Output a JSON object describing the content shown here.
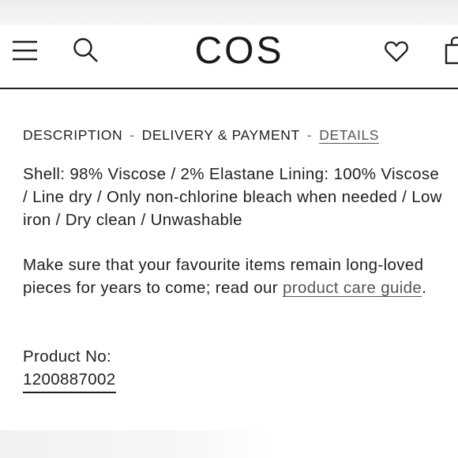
{
  "header": {
    "logo_text": "COS",
    "icons": [
      "menu-icon",
      "search-icon",
      "heart-icon",
      "bag-icon"
    ]
  },
  "tabs": {
    "description": "DESCRIPTION",
    "separator": "-",
    "delivery": "DELIVERY & PAYMENT",
    "details": "DETAILS",
    "active": "DETAILS"
  },
  "details": {
    "composition_care": "Shell: 98% Viscose / 2% Elastane Lining: 100% Viscose / Line dry / Only non-chlorine bleach when needed / Low iron / Dry clean / Unwashable",
    "care_text_before_link": "Make sure that your favourite items remain long-loved pieces for years to come; read our ",
    "care_link": "product care guide",
    "care_text_after_link": ".",
    "product_no_label": "Product No:",
    "product_no_value": "1200887002"
  },
  "colors": {
    "text": "#1f1f1f",
    "link": "#555555",
    "background": "#ffffff"
  }
}
